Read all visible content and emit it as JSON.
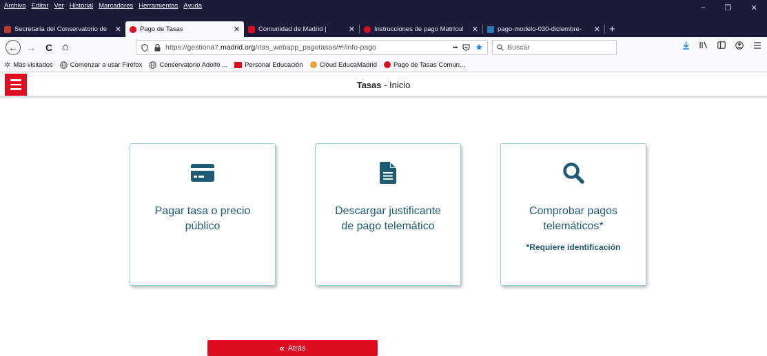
{
  "menu": [
    "Archivo",
    "Editar",
    "Ver",
    "Historial",
    "Marcadores",
    "Herramientas",
    "Ayuda"
  ],
  "window_controls": {
    "minimize": "–",
    "restore": "❐",
    "close": "✕"
  },
  "tabs": [
    {
      "title": "Secretaría del Conservatorio de",
      "favicon_color": "#c0392b",
      "active": false,
      "close": "✕"
    },
    {
      "title": "Pago de Tasas",
      "favicon_color": "#e00c1f",
      "active": true,
      "close": "✕"
    },
    {
      "title": "Comunidad de Madrid |",
      "favicon_color": "#e00c1f",
      "active": false,
      "close": "✕"
    },
    {
      "title": "Instrucciones de pago Matrícul",
      "favicon_color": "#e00c1f",
      "active": false,
      "close": "✕"
    },
    {
      "title": "pago-modelo-030-diciembre-",
      "favicon_color": "#2a7ab8",
      "active": false,
      "close": "✕"
    }
  ],
  "new_tab": "+",
  "nav": {
    "back": "←",
    "forward": "→",
    "reload": "C",
    "home": "⌂",
    "url_prefix": "https://gestiona7.",
    "url_domain": "madrid.org",
    "url_path": "/rtas_webapp_pagotasas/#!/info-pago",
    "url_more": "•••",
    "search_placeholder": "Buscar"
  },
  "bookmarks": [
    {
      "label": "Más visitados",
      "icon_color": "#555555"
    },
    {
      "label": "Comenzar a usar Firefox",
      "icon_color": "#555555"
    },
    {
      "label": "Conservatorio Adolfo ...",
      "icon_color": "#555555"
    },
    {
      "label": "Personal Educación",
      "icon_color": "#e00c1f"
    },
    {
      "label": "Cloud EducaMadrid",
      "icon_color": "#e8a33d"
    },
    {
      "label": "Pago de Tasas Comun...",
      "icon_color": "#e00c1f"
    }
  ],
  "header": {
    "title_bold": "Tasas",
    "title_rest": " - Inicio"
  },
  "cards": [
    {
      "title": "Pagar tasa o precio público",
      "note": "",
      "icon": "credit-card-icon"
    },
    {
      "title": "Descargar justificante de pago telemático",
      "note": "",
      "icon": "document-icon"
    },
    {
      "title": "Comprobar pagos telemáticos*",
      "note": "*Requiere identificación",
      "icon": "search-icon"
    }
  ],
  "back_button": {
    "icon": "«",
    "label": "Atrás"
  },
  "colors": {
    "brand_red": "#e00c1f",
    "card_text": "#1e5b74",
    "card_border": "#8fd1d8"
  }
}
